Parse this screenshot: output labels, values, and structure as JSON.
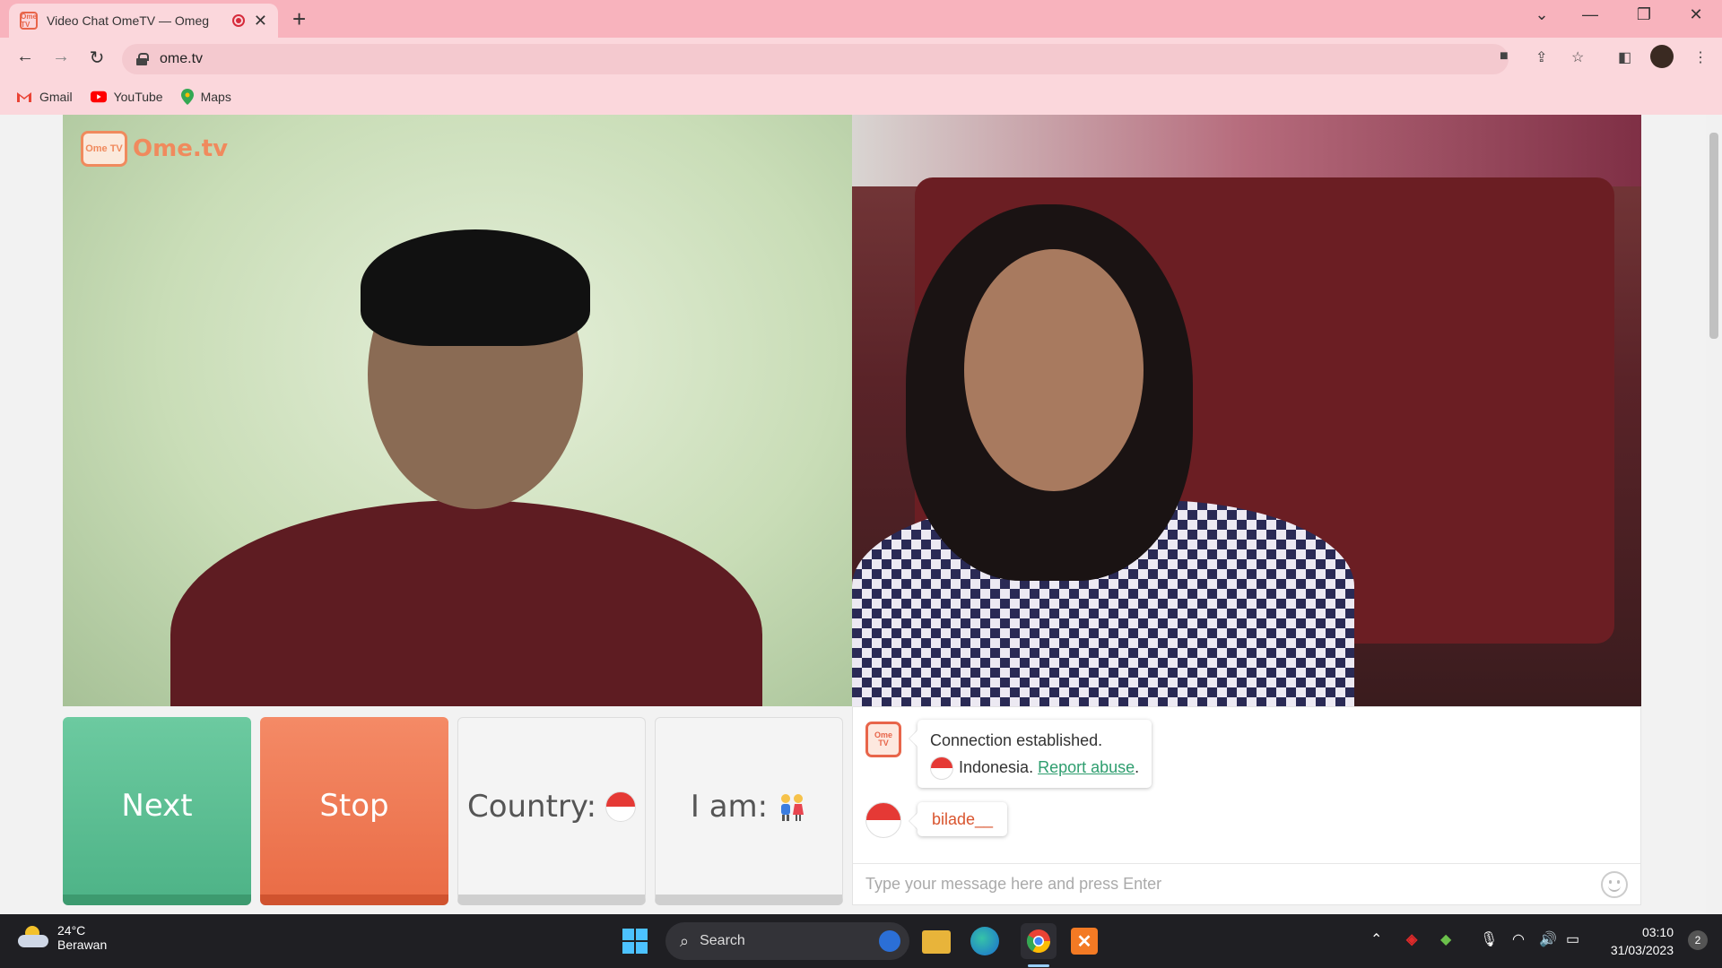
{
  "browser": {
    "tab_title": "Video Chat OmeTV — Omeg",
    "favicon_text": "Ome TV",
    "url": "ome.tv",
    "bookmarks": [
      {
        "label": "Gmail",
        "icon": "gmail-icon"
      },
      {
        "label": "YouTube",
        "icon": "youtube-icon"
      },
      {
        "label": "Maps",
        "icon": "maps-icon"
      }
    ]
  },
  "site": {
    "logo_badge": "Ome TV",
    "logo_text": "Ome.tv"
  },
  "controls": {
    "next_label": "Next",
    "stop_label": "Stop",
    "country_label": "Country:",
    "iam_label": "I am:",
    "iam_icon": "couple-icon"
  },
  "chat": {
    "system_message": "Connection established.",
    "country": "Indonesia.",
    "report_link": "Report abuse",
    "report_suffix": ".",
    "partner_nick": "bilade__",
    "input_placeholder": "Type your message here and press Enter"
  },
  "taskbar": {
    "temperature": "24°C",
    "weather_desc": "Berawan",
    "search_label": "Search",
    "time": "03:10",
    "date": "31/03/2023",
    "notification_count": "2"
  },
  "colors": {
    "next_green": "#4fb488",
    "stop_orange": "#ea6d47",
    "brand_orange": "#f08a5d",
    "tab_bar_pink": "#f8b3bd"
  }
}
